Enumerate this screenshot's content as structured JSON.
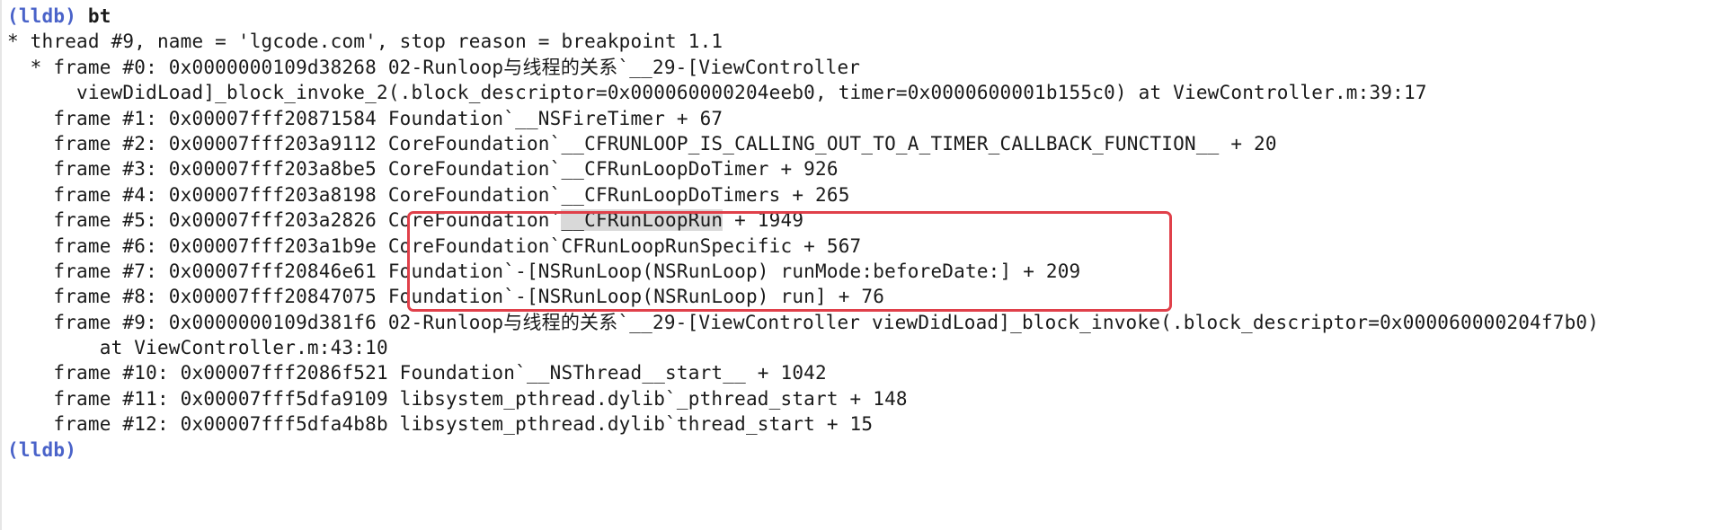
{
  "prompt": "(lldb)",
  "command": "bt",
  "highlight_color": "#e0404a",
  "prompt_color": "#4a63c9",
  "lines": {
    "thread": "* thread #9, name = 'lgcode.com', stop reason = breakpoint 1.1",
    "f0a": "  * frame #0: 0x0000000109d38268 02-Runloop与线程的关系`__29-[ViewController",
    "f0b": "      viewDidLoad]_block_invoke_2(.block_descriptor=0x000060000204eeb0, timer=0x0000600001b155c0) at ViewController.m:39:17",
    "f1": "    frame #1: 0x00007fff20871584 Foundation`__NSFireTimer + 67",
    "f2": "    frame #2: 0x00007fff203a9112 CoreFoundation`__CFRUNLOOP_IS_CALLING_OUT_TO_A_TIMER_CALLBACK_FUNCTION__ + 20",
    "f3": "    frame #3: 0x00007fff203a8be5 CoreFoundation`__CFRunLoopDoTimer + 926",
    "f4": "    frame #4: 0x00007fff203a8198 CoreFoundation`__CFRunLoopDoTimers + 265",
    "f5_pre": "    frame #5: 0x00007fff203a2826 CoreFoundation`",
    "f5_sel": "__CFRunLoopRun",
    "f5_post": " + 1949",
    "f6": "    frame #6: 0x00007fff203a1b9e CoreFoundation`CFRunLoopRunSpecific + 567",
    "f7": "    frame #7: 0x00007fff20846e61 Foundation`-[NSRunLoop(NSRunLoop) runMode:beforeDate:] + 209",
    "f8": "    frame #8: 0x00007fff20847075 Foundation`-[NSRunLoop(NSRunLoop) run] + 76",
    "f9a": "    frame #9: 0x0000000109d381f6 02-Runloop与线程的关系`__29-[ViewController viewDidLoad]_block_invoke(.block_descriptor=0x000060000204f7b0)",
    "f9b": "        at ViewController.m:43:10",
    "f10": "    frame #10: 0x00007fff2086f521 Foundation`__NSThread__start__ + 1042",
    "f11": "    frame #11: 0x00007fff5dfa9109 libsystem_pthread.dylib`_pthread_start + 148",
    "f12": "    frame #12: 0x00007fff5dfa4b8b libsystem_pthread.dylib`thread_start + 15"
  }
}
